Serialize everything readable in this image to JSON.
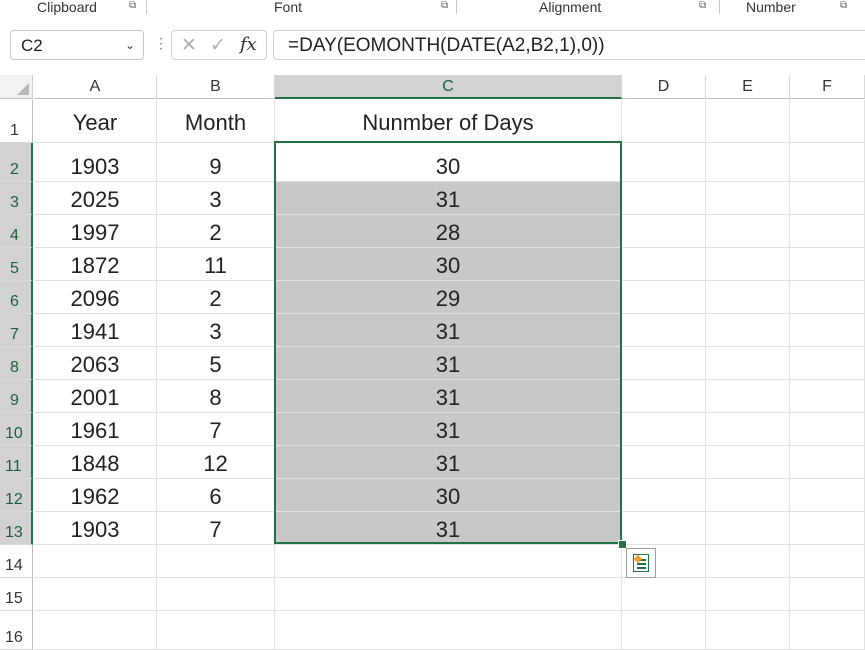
{
  "ribbon": {
    "groups": [
      {
        "label": "Clipboard"
      },
      {
        "label": "Font"
      },
      {
        "label": "Alignment"
      },
      {
        "label": "Number"
      }
    ]
  },
  "formula_bar": {
    "name_box": "C2",
    "cancel_icon": "✕",
    "enter_icon": "✓",
    "fx_label": "fx",
    "formula": "=DAY(EOMONTH(DATE(A2,B2,1),0))"
  },
  "columns": [
    "A",
    "B",
    "C",
    "D",
    "E",
    "F"
  ],
  "rows": [
    "1",
    "2",
    "3",
    "4",
    "5",
    "6",
    "7",
    "8",
    "9",
    "10",
    "11",
    "12",
    "13",
    "14",
    "15",
    "16"
  ],
  "headers": {
    "year": "Year",
    "month": "Month",
    "days": "Nunmber of Days"
  },
  "data": [
    {
      "year": "1903",
      "month": "9",
      "days": "30"
    },
    {
      "year": "2025",
      "month": "3",
      "days": "31"
    },
    {
      "year": "1997",
      "month": "2",
      "days": "28"
    },
    {
      "year": "1872",
      "month": "11",
      "days": "30"
    },
    {
      "year": "2096",
      "month": "2",
      "days": "29"
    },
    {
      "year": "1941",
      "month": "3",
      "days": "31"
    },
    {
      "year": "2063",
      "month": "5",
      "days": "31"
    },
    {
      "year": "2001",
      "month": "8",
      "days": "31"
    },
    {
      "year": "1961",
      "month": "7",
      "days": "31"
    },
    {
      "year": "1848",
      "month": "12",
      "days": "31"
    },
    {
      "year": "1962",
      "month": "6",
      "days": "30"
    },
    {
      "year": "1903",
      "month": "7",
      "days": "31"
    }
  ],
  "colors": {
    "accent": "#217346",
    "selection_fill": "#c8c8c8",
    "header_selected": "#d2d2d2"
  }
}
